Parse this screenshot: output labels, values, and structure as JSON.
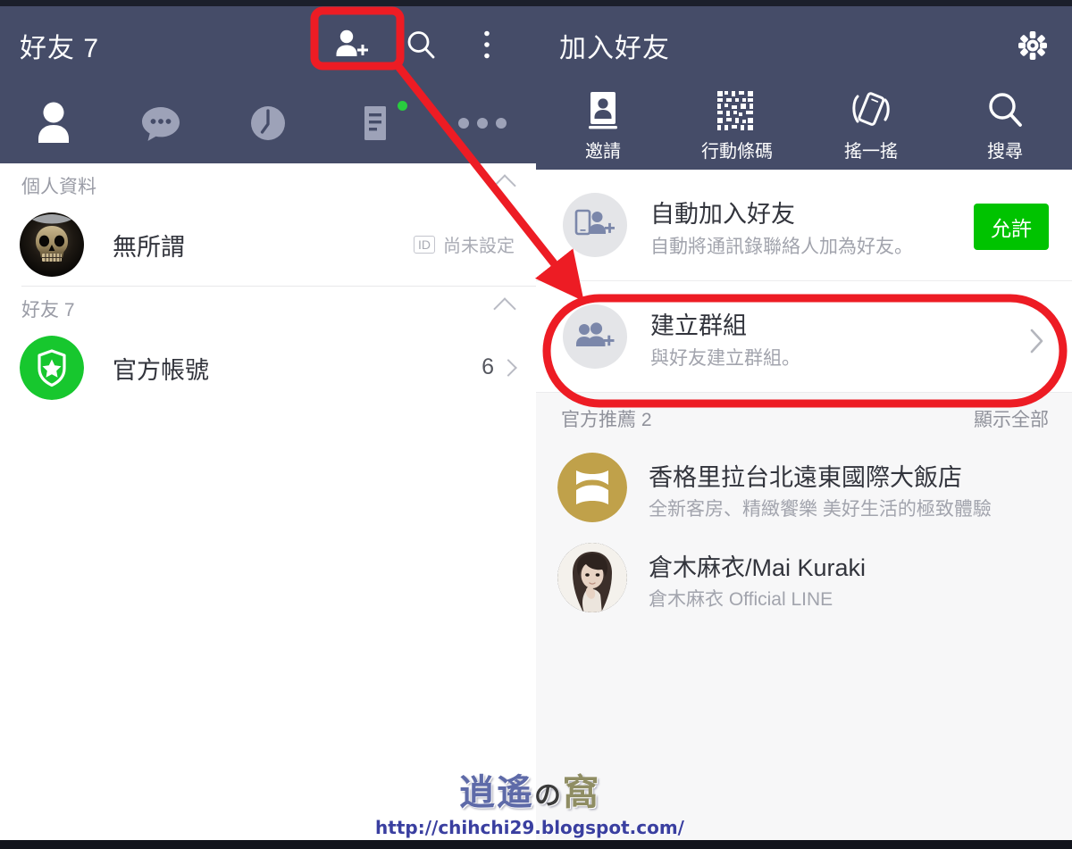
{
  "left_panel": {
    "header": {
      "title": "好友 7",
      "icons": [
        "add-friend-icon",
        "search-icon",
        "overflow-menu-icon"
      ]
    },
    "tabs": [
      {
        "name": "friends",
        "icon": "person-icon",
        "active": true,
        "badge": false
      },
      {
        "name": "chats",
        "icon": "chat-bubble-icon",
        "active": false,
        "badge": false
      },
      {
        "name": "timeline",
        "icon": "clock-icon",
        "active": false,
        "badge": false
      },
      {
        "name": "news",
        "icon": "news-document-icon",
        "active": false,
        "badge": true
      },
      {
        "name": "more",
        "icon": "more-dots-icon",
        "active": false,
        "badge": false
      }
    ],
    "sections": [
      {
        "label": "個人資料",
        "rows": [
          {
            "name": "無所謂",
            "avatar": "skull-avatar",
            "badge_label": "ID",
            "right_text": "尚未設定",
            "chevron": false
          }
        ]
      },
      {
        "label": "好友 7",
        "rows": [
          {
            "name": "官方帳號",
            "avatar": "official-shield-avatar",
            "badge_label": "",
            "right_text": "6",
            "chevron": true
          }
        ]
      }
    ]
  },
  "right_panel": {
    "header": {
      "title": "加入好友",
      "settings_icon": "gear-icon"
    },
    "actions": [
      {
        "label": "邀請",
        "icon": "address-book-icon"
      },
      {
        "label": "行動條碼",
        "icon": "qr-code-icon"
      },
      {
        "label": "搖一搖",
        "icon": "shake-phone-icon"
      },
      {
        "label": "搜尋",
        "icon": "search-icon"
      }
    ],
    "items": [
      {
        "title": "自動加入好友",
        "subtitle": "自動將通訊錄聯絡人加為好友。",
        "icon": "phone-contact-add-icon",
        "action_label": "允許",
        "action_color": "#00C300",
        "chevron": false
      },
      {
        "title": "建立群組",
        "subtitle": "與好友建立群組。",
        "icon": "group-add-icon",
        "action_label": "",
        "action_color": "",
        "chevron": true
      }
    ],
    "recommend": {
      "label": "官方推薦 2",
      "show_all": "顯示全部",
      "rows": [
        {
          "name": "香格里拉台北遠東國際大飯店",
          "desc": "全新客房、精緻饗樂 美好生活的極致體驗",
          "avatar": "shangrila-logo-avatar"
        },
        {
          "name": "倉木麻衣/Mai Kuraki",
          "desc": "倉木麻衣 Official LINE",
          "avatar": "mai-kuraki-photo-avatar"
        }
      ]
    }
  },
  "annotations": {
    "color": "#ED1C24",
    "highlight_box": "add-friend-button-highlight",
    "arrow": "arrow-to-create-group",
    "highlight_oval": "create-group-row-highlight"
  },
  "watermark": {
    "logo_text_1": "逍遙",
    "logo_text_2": "の",
    "logo_text_3": "窩",
    "url": "http://chihchi29.blogspot.com/"
  },
  "theme": {
    "header_bg": "#454C68",
    "tab_icon_inactive": "#9DA2B8",
    "panel_bg": "#F7F7F8",
    "accent_green": "#00C300",
    "annotation_red": "#ED1C24"
  }
}
